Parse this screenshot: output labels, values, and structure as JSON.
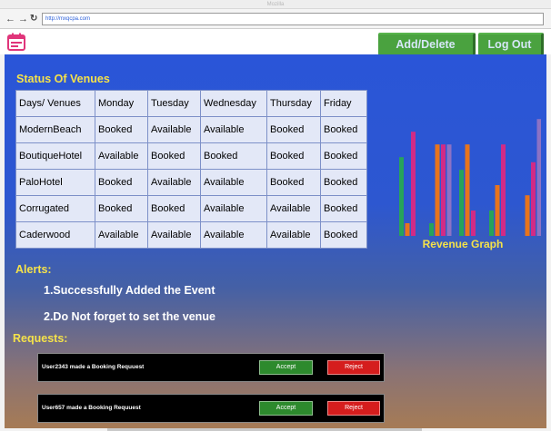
{
  "browser": {
    "window_title": "Mozilla",
    "url": "http://mxqcpa.com",
    "nav_icons": [
      "back-arrow-icon",
      "forward-arrow-icon",
      "reload-icon"
    ]
  },
  "header": {
    "logo_icon": "calendar-icon",
    "venue_button": "Add/Delete Venue",
    "logout_button": "Log Out"
  },
  "status": {
    "title": "Status Of Venues",
    "columns": [
      "Days/ Venues",
      "Monday",
      "Tuesday",
      "Wednesday",
      "Thursday",
      "Friday"
    ],
    "rows": [
      [
        "ModernBeach",
        "Booked",
        "Available",
        "Available",
        "Booked",
        "Booked"
      ],
      [
        "BoutiqueHotel",
        "Available",
        "Booked",
        "Booked",
        "Booked",
        "Booked"
      ],
      [
        "PaloHotel",
        "Booked",
        "Available",
        "Available",
        "Booked",
        "Booked"
      ],
      [
        "Corrugated",
        "Booked",
        "Booked",
        "Available",
        "Available",
        "Booked"
      ],
      [
        "Caderwood",
        "Available",
        "Available",
        "Available",
        "Available",
        "Booked"
      ]
    ]
  },
  "chart_data": {
    "type": "bar",
    "title": "Revenue Graph",
    "xlabel": "",
    "ylabel": "",
    "colors": [
      "#27a35a",
      "#e8741c",
      "#d12b86",
      "#8c72c4"
    ],
    "groups": [
      [
        62,
        10,
        82,
        0
      ],
      [
        10,
        72,
        72,
        72
      ],
      [
        52,
        72,
        20,
        0
      ],
      [
        20,
        40,
        72,
        0
      ],
      [
        0,
        32,
        58,
        92
      ],
      [
        62,
        62,
        62,
        0
      ]
    ],
    "ylim": [
      0,
      100
    ]
  },
  "alerts": {
    "title": "Alerts:",
    "items": [
      "1.Successfully Added the Event",
      "2.Do Not forget to set the venue"
    ]
  },
  "requests": {
    "title": "Requests:",
    "items": [
      {
        "text": "User2343 made a Booking Requuest",
        "accept": "Accept",
        "reject": "Reject"
      },
      {
        "text": "User657 made a Booking Requuest",
        "accept": "Accept",
        "reject": "Reject"
      }
    ]
  }
}
